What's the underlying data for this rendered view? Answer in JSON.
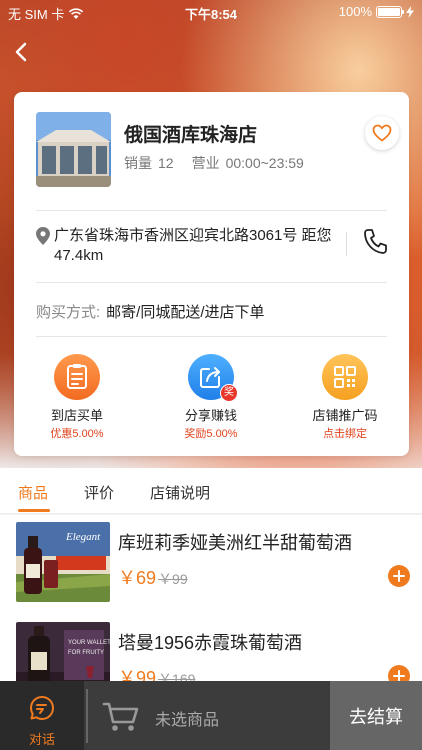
{
  "status_bar": {
    "carrier": "无 SIM 卡",
    "time": "下午8:54",
    "battery": "100%"
  },
  "store": {
    "name": "俄国酒库珠海店",
    "sales_label": "销量",
    "sales_value": "12",
    "hours_label": "营业",
    "hours_value": "00:00~23:59",
    "address": "广东省珠海市香洲区迎宾北路3061号  距您47.4km",
    "purchase_label": "购买方式:",
    "purchase_value": "邮寄/同城配送/进店下单"
  },
  "actions": [
    {
      "label": "到店买单",
      "sub": "优惠5.00%",
      "icon": "receipt-icon"
    },
    {
      "label": "分享赚钱",
      "sub": "奖励5.00%",
      "icon": "share-icon",
      "badge": "奖"
    },
    {
      "label": "店铺推广码",
      "sub": "点击绑定",
      "icon": "qrcode-icon"
    }
  ],
  "tabs": [
    {
      "label": "商品",
      "active": true
    },
    {
      "label": "评价",
      "active": false
    },
    {
      "label": "店铺说明",
      "active": false
    }
  ],
  "products": [
    {
      "name": "库班莉季娅美洲红半甜葡萄酒",
      "currency": "￥",
      "price": "69",
      "old_price": "￥99"
    },
    {
      "name": "塔曼1956赤霞珠葡萄酒",
      "currency": "￥",
      "price": "99",
      "old_price": "￥169"
    }
  ],
  "cart": {
    "chat_label": "对话",
    "empty_label": "未选商品",
    "checkout_label": "去结算"
  },
  "colors": {
    "accent": "#f07b1f",
    "discount_text": "#e0421c"
  }
}
